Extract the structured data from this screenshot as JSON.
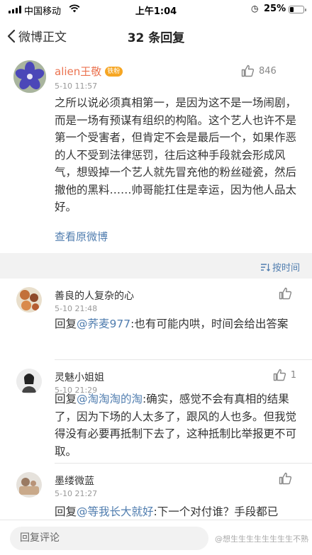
{
  "status_bar": {
    "carrier": "中国移动",
    "time": "上午1:04",
    "battery": "25%",
    "battery_level": 0.25
  },
  "nav": {
    "back_label": "微博正文",
    "title": "32 条回复"
  },
  "original_post": {
    "author": "alien王敬",
    "badge": "铁粉",
    "time": "5-10 11:57",
    "likes": "846",
    "text": "之所以说必须真相第一，是因为这不是一场闹剧，而是一场有预谋有组织的构陷。这个艺人也许不是第一个受害者，但肯定不会是最后一个，如果作恶的人不受到法律惩罚，往后这种手段就会形成风气，想毁掉一个艺人就先冒充他的粉丝碰瓷，然后撤他的黑料……帅哥能扛住是幸运，因为他人品太好。",
    "view_original": "查看原微博"
  },
  "sort": {
    "label": "按时间"
  },
  "comments": [
    {
      "author": "善良的人复杂的心",
      "time": "5-10 21:48",
      "likes": "",
      "reply_prefix": "回复",
      "mention": "@荞麦977",
      "text": ":也有可能内哄，时间会给出答案"
    },
    {
      "author": "灵魅小姐姐",
      "time": "5-10 21:29",
      "likes": "1",
      "reply_prefix": "回复",
      "mention": "@淘淘淘的淘",
      "text": ":确实，感觉不会有真相的结果了，因为下场的人太多了，跟风的人也多。但我觉得没有必要再抵制下去了，这种抵制比举报更不可取。"
    },
    {
      "author": "墨缕微蓝",
      "time": "5-10 21:27",
      "likes": "",
      "reply_prefix": "回复",
      "mention": "@等我长大就好",
      "text": ":下一个对付谁？手段都已"
    }
  ],
  "bottom_bar": {
    "reply_placeholder": "回复评论",
    "watermark": "@想生生生生生生生生不熟"
  },
  "colors": {
    "author_orange": "#eb7350",
    "link_blue": "#507daf",
    "badge_orange": "#f6a623"
  },
  "icons": [
    "back-chevron-icon",
    "thumbs-up-icon",
    "sort-icon",
    "signal-icon",
    "wifi-icon",
    "alarm-icon",
    "battery-icon"
  ]
}
